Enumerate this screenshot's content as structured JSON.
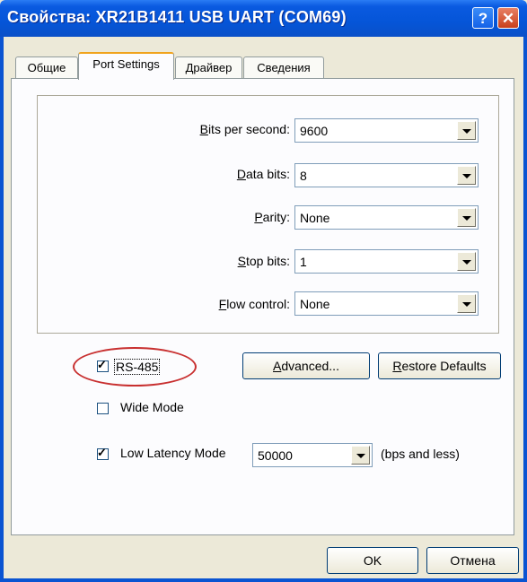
{
  "window": {
    "title": "Свойства: XR21B1411 USB UART (COM69)",
    "help_glyph": "?",
    "close_glyph": "✕"
  },
  "tabs": [
    {
      "label": "Общие"
    },
    {
      "label": "Port Settings",
      "active": true
    },
    {
      "label": "Драйвер"
    },
    {
      "label": "Сведения"
    }
  ],
  "settings": {
    "bits_per_second": {
      "label_key": "B",
      "label_rest": "its per second:",
      "value": "9600"
    },
    "data_bits": {
      "label_key": "D",
      "label_rest": "ata bits:",
      "value": "8"
    },
    "parity": {
      "label_key": "P",
      "label_rest": "arity:",
      "value": "None"
    },
    "stop_bits": {
      "label_key": "S",
      "label_rest": "top bits:",
      "value": "1"
    },
    "flow_control": {
      "label_key": "F",
      "label_rest": "low control:",
      "value": "None"
    }
  },
  "options": {
    "rs485": {
      "label": "RS-485",
      "checked": true
    },
    "wide_mode": {
      "label": "Wide Mode",
      "checked": false
    },
    "low_latency": {
      "label": "Low Latency Mode",
      "checked": true,
      "value": "50000",
      "suffix": "(bps and less)"
    }
  },
  "buttons": {
    "advanced_key": "A",
    "advanced_rest": "dvanced...",
    "restore_key": "R",
    "restore_rest": "estore Defaults",
    "ok": "OK",
    "cancel": "Отмена"
  },
  "check_glyph": "✓"
}
